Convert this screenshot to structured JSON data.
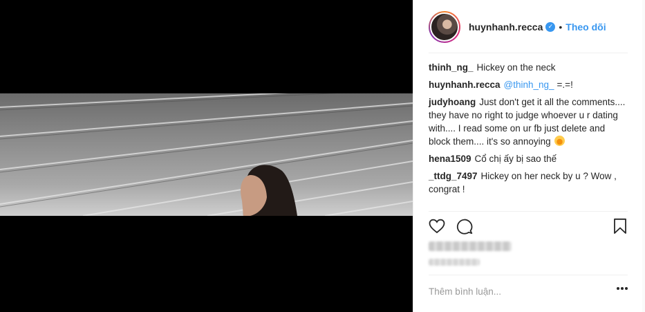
{
  "post": {
    "username": "huynhanh.recca",
    "follow_label": "Theo dõi",
    "separator": "•"
  },
  "comments": [
    {
      "author": "thinh_ng_",
      "text": "Hickey on the neck"
    },
    {
      "author": "huynhanh.recca",
      "mention": "@thinh_ng_",
      "text": "=.=!"
    },
    {
      "author": "judyhoang",
      "text": "Just don't get it all the comments.... they have no right to judge whoever u r dating with.... I read some on ur fb just delete and block them.... it's so annoying",
      "emoji": "rolling-on-floor-laughing-emoji"
    },
    {
      "author": "hena1509",
      "text": "Cổ chị ấy bị sao thế"
    },
    {
      "author": "_ttdg_7497",
      "text": "Hickey on her neck by u ? Wow , congrat !"
    }
  ],
  "icons": {
    "like": "heart-icon",
    "comment": "comment-bubble-icon",
    "save": "bookmark-icon",
    "options": "more-options-icon",
    "verified": "verified-badge-icon"
  },
  "comment_input": {
    "placeholder": "Thêm bình luận..."
  },
  "colors": {
    "link": "#3897f0",
    "text": "#262626",
    "muted": "#999999",
    "divider": "#efefef"
  }
}
